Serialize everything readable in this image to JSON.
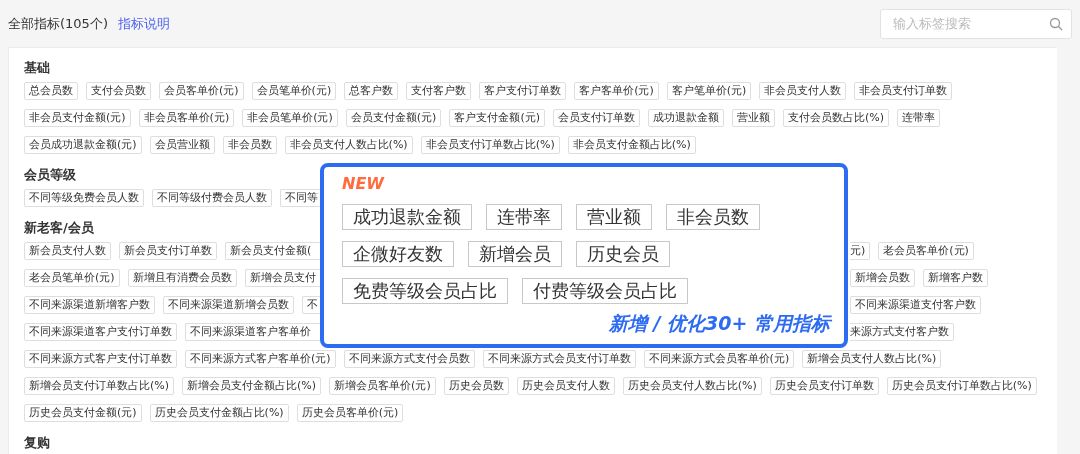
{
  "header": {
    "title": "全部指标(105个)",
    "link": "指标说明"
  },
  "search": {
    "placeholder": "输入标签搜索"
  },
  "sections": [
    {
      "title": "基础",
      "rows": [
        {
          "tags": [
            "总会员数",
            "支付会员数",
            "会员客单价(元)",
            "会员笔单价(元)",
            "总客户数",
            "支付客户数",
            "客户支付订单数",
            "客户客单价(元)",
            "客户笔单价(元)",
            "非会员支付人数",
            "非会员支付订单数"
          ]
        },
        {
          "tags": [
            "非会员支付金额(元)",
            "非会员客单价(元)",
            "非会员笔单价(元)",
            "会员支付金额(元)",
            "客户支付金额(元)",
            "会员支付订单数",
            "成功退款金额",
            "营业额",
            "支付会员数占比(%)",
            "连带率"
          ]
        },
        {
          "tags": [
            "会员成功退款金额(元)",
            "会员营业额",
            "非会员数",
            "非会员支付人数占比(%)",
            "非会员支付订单数占比(%)",
            "非会员支付金额占比(%)"
          ]
        }
      ]
    },
    {
      "title": "会员等级",
      "rows": [
        {
          "tags": [
            "不同等级免费会员人数",
            "不同等级付费会员人数"
          ],
          "cut_tag": "不同等"
        }
      ]
    },
    {
      "title": "新老客/会员",
      "rows": [
        {
          "tags": [
            "新会员支付人数",
            "新会员支付订单数"
          ],
          "cut_tag": "新会员支付金额(",
          "right_cut_tag": "元)",
          "right_tags": [
            "老会员客单价(元)"
          ]
        },
        {
          "tags": [
            "老会员笔单价(元)",
            "新增且有消费会员数"
          ],
          "cut_tag": "新增会员支付",
          "right_tags": [
            "新增会员数",
            "新增客户数"
          ]
        },
        {
          "tags": [
            "不同来源渠道新增客户数",
            "不同来源渠道新增会员数"
          ],
          "cut_tag": "不",
          "right_tags": [
            "不同来源渠道支付客户数"
          ]
        },
        {
          "tags": [
            "不同来源渠道客户支付订单数"
          ],
          "cut_tag": "不同来源渠道客户客单价",
          "right_cut_tag": "来源方式支付客户数"
        },
        {
          "tags": [
            "不同来源方式客户支付订单数",
            "不同来源方式客户客单价(元)",
            "不同来源方式支付会员数",
            "不同来源方式会员支付订单数",
            "不同来源方式会员客单价(元)",
            "新增会员支付人数占比(%)"
          ]
        },
        {
          "tags": [
            "新增会员支付订单数占比(%)",
            "新增会员支付金额占比(%)",
            "新增会员客单价(元)",
            "历史会员数",
            "历史会员支付人数",
            "历史会员支付人数占比(%)",
            "历史会员支付订单数",
            "历史会员支付订单数占比(%)"
          ]
        },
        {
          "tags": [
            "历史会员支付金额(元)",
            "历史会员支付金额占比(%)",
            "历史会员客单价(元)"
          ]
        }
      ]
    },
    {
      "title": "复购"
    }
  ],
  "popup": {
    "badge": "NEW",
    "rows": [
      [
        "成功退款金额",
        "连带率",
        "营业额",
        "非会员数"
      ],
      [
        "企微好友数",
        "新增会员",
        "历史会员"
      ],
      [
        "免费等级会员占比",
        "付费等级会员占比"
      ]
    ],
    "footer": "新增 / 优化30+ 常用指标"
  }
}
